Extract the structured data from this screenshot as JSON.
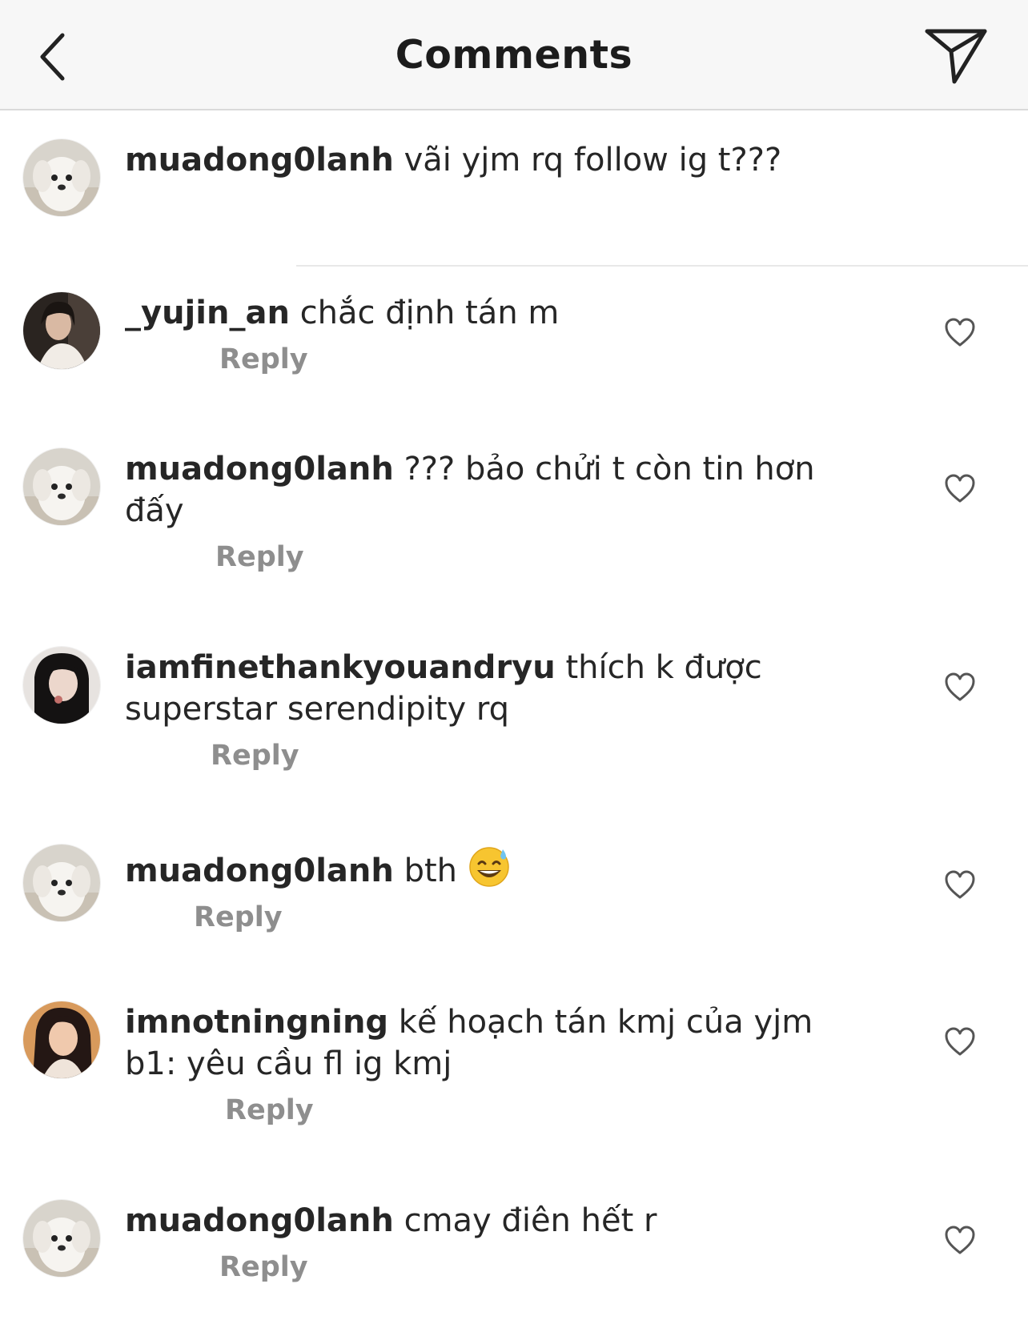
{
  "header": {
    "title": "Comments",
    "back_icon": "chevron-left-icon",
    "send_icon": "paper-plane-icon"
  },
  "caption": {
    "username": "muadong0lanh",
    "text": "vãi yjm rq follow ig t???"
  },
  "comments": [
    {
      "username": "_yujin_an",
      "text": "chắc định tán m",
      "reply_label": "Reply",
      "avatar": "dark-portrait"
    },
    {
      "username": "muadong0lanh",
      "text": "??? bảo chửi t còn tin hơn đấy",
      "reply_label": "Reply",
      "avatar": "white-puppy"
    },
    {
      "username": "iamfinethankyouandryu",
      "text": "thích k được superstar serendipity rq",
      "reply_label": "Reply",
      "avatar": "dark-portrait"
    },
    {
      "username": "muadong0lanh",
      "text": "bth",
      "emoji": "grinning-sweat-emoji",
      "reply_label": "Reply",
      "avatar": "white-puppy"
    },
    {
      "username": "imnotningning",
      "text": "kế hoạch tán kmj của yjm b1: yêu cầu fl ig kmj",
      "reply_label": "Reply",
      "avatar": "warm-portrait"
    },
    {
      "username": "muadong0lanh",
      "text": "cmay điên hết r",
      "reply_label": "Reply",
      "avatar": "white-puppy"
    }
  ],
  "colors": {
    "header_bg": "#f7f7f7",
    "text": "#262626",
    "muted": "#8e8e8e",
    "divider": "#dadada"
  }
}
